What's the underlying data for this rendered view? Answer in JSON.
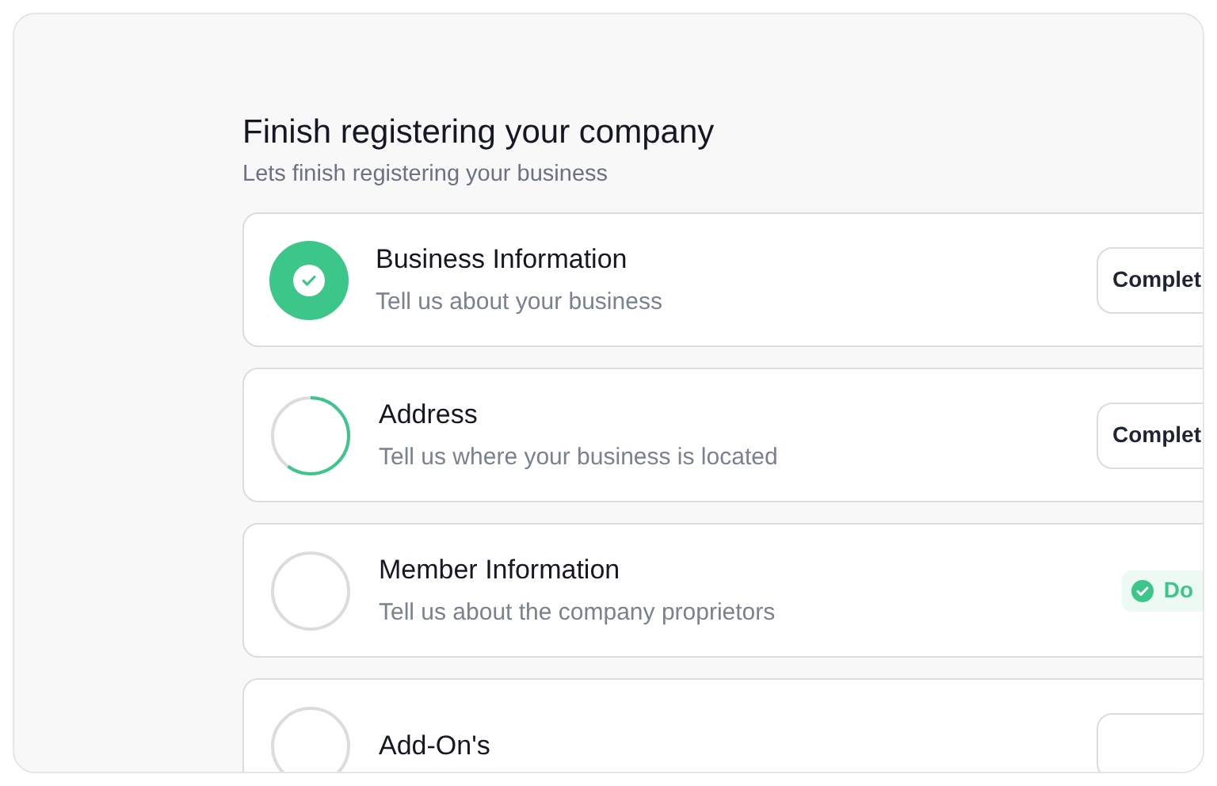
{
  "header": {
    "title": "Finish registering your company",
    "subtitle": "Lets finish registering your business"
  },
  "steps": [
    {
      "title": "Business Information",
      "description": "Tell us about your business",
      "completed": true,
      "action": {
        "kind": "button",
        "label": "Complet"
      }
    },
    {
      "title": "Address",
      "description": "Tell us where your business is located",
      "completed": false,
      "level": 0.6,
      "action": {
        "kind": "button",
        "label": "Complet"
      }
    },
    {
      "title": "Member Information",
      "description": "Tell us about the company proprietors",
      "completed": false,
      "level": 0,
      "action": {
        "kind": "badge",
        "label": "Do"
      }
    },
    {
      "title": "Add-On's",
      "completed": false,
      "level": 0,
      "action": {
        "kind": "button"
      }
    }
  ]
}
